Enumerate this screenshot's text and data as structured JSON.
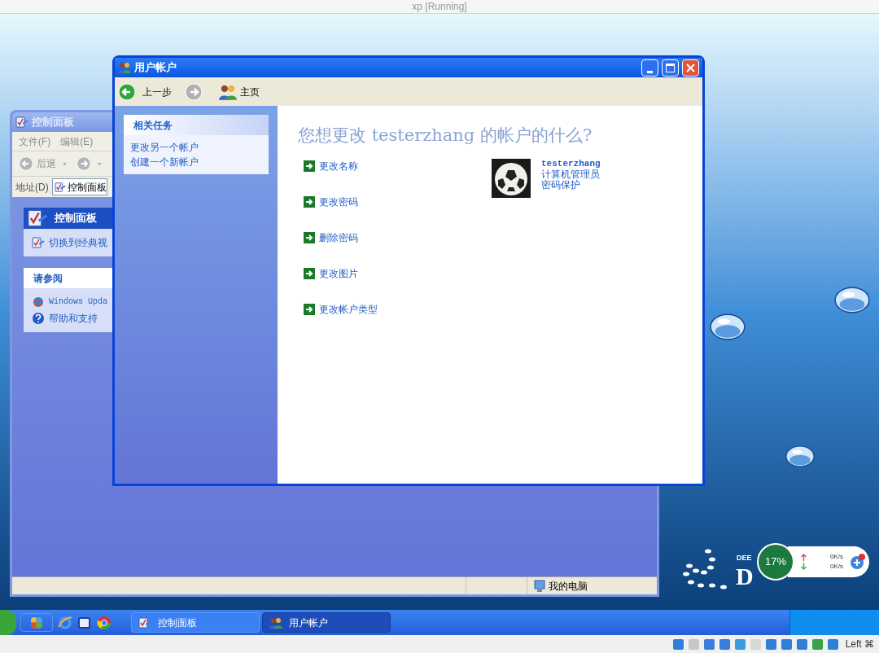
{
  "host": {
    "title": "xp [Running]",
    "key_label": "Left ⌘"
  },
  "back_window": {
    "title": "控制面板",
    "menu": [
      "文件(F)",
      "编辑(E)"
    ],
    "back_label": "后退",
    "address": {
      "label": "地址(D)",
      "value": "控制面板"
    },
    "panes": [
      {
        "title": "控制面板",
        "kind": "header",
        "items": [
          {
            "label": "切换到经典视",
            "kind": "classic"
          }
        ]
      },
      {
        "title": "请参阅",
        "kind": "plain",
        "items": [
          {
            "label": "Windows Upda",
            "kind": "update"
          },
          {
            "label": "帮助和支持",
            "kind": "help"
          }
        ]
      }
    ],
    "status_location": "我的电脑"
  },
  "front_window": {
    "title": "用户帐户",
    "toolbar": {
      "back": "上一步",
      "forward_disabled": true,
      "home": "主页"
    },
    "tasks": {
      "title": "相关任务",
      "links": [
        "更改另一个帐户",
        "创建一个新帐户"
      ]
    },
    "heading": "您想更改 testerzhang 的帐户的什么?",
    "actions": [
      "更改名称",
      "更改密码",
      "删除密码",
      "更改图片",
      "更改帐户类型"
    ],
    "account": {
      "name": "testerzhang",
      "type": "计算机管理员",
      "status": "密码保护"
    }
  },
  "wallpaper_logo": {
    "small": "DEE",
    "large": "D"
  },
  "monitor": {
    "cpu": {
      "reading": "17%"
    },
    "upload": "0K/s",
    "download": "0K/s"
  },
  "taskbar": {
    "tasks": [
      {
        "label": "控制面板",
        "kind": "control-panel",
        "selected": false
      },
      {
        "label": "用户帐户",
        "kind": "users",
        "selected": true
      }
    ]
  }
}
